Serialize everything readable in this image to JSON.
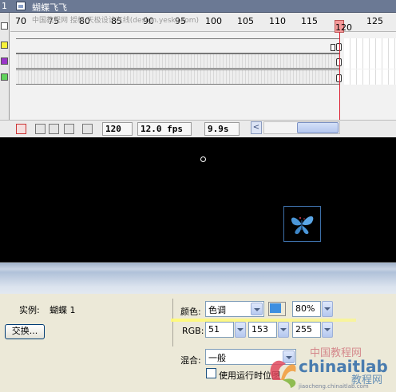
{
  "scene": {
    "number": "1",
    "title": "蝴蝶飞飞"
  },
  "watermark_top": "中国教程网 授权 天极设计在线(design.yesky.com)",
  "timeline": {
    "ruler_labels": [
      "70",
      "75",
      "80",
      "85",
      "90",
      "95",
      "100",
      "105",
      "110",
      "115",
      "120",
      "125"
    ],
    "current_frame_label": "120",
    "frame": "120",
    "fps": "12.0 fps",
    "elapsed": "9.9s",
    "scroll_left": "<",
    "layer_colors": [
      "#f7f23a",
      "#9b35c9",
      "#5fd35a"
    ]
  },
  "properties": {
    "instance_label": "实例:",
    "instance_name": "蝴蝶 1",
    "swap_button": "交换...",
    "color_label": "颜色:",
    "color_mode": "色调",
    "tint_color": "#3e8fe0",
    "tint_amount": "80%",
    "rgb_label": "RGB:",
    "r": "51",
    "g": "153",
    "b": "255",
    "blend_label": "混合:",
    "blend_mode": "一般",
    "runtime_bitmap_label": "使用运行时位图"
  },
  "watermark_logo": {
    "line1": "中国教程网",
    "line2": "chinaitlab",
    "line3": "教程网",
    "line4": "jiaocheng.chinaitlab.com"
  }
}
